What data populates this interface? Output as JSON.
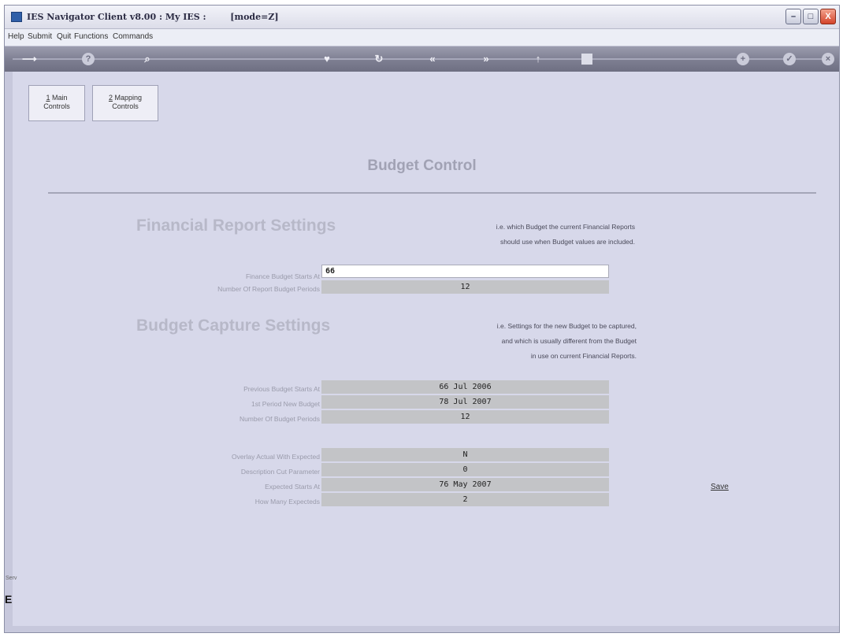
{
  "window": {
    "title": "IES Navigator Client v8.00 : My IES :        [mode=Z]",
    "buttons": {
      "minimize": "–",
      "maximize": "□",
      "close": "X"
    }
  },
  "menu": {
    "items": [
      "Help",
      "Submit",
      "Quit",
      "Functions",
      "Commands"
    ]
  },
  "toolbar": {
    "icons": [
      "arrow-right-icon",
      "help-icon",
      "search-icon",
      "heart-icon",
      "refresh-icon",
      "back-icon",
      "forward-icon",
      "up-icon",
      "stop-icon",
      "add-icon",
      "check-icon",
      "close-icon"
    ],
    "glyphs": {
      "arrow": "⟶",
      "help": "?",
      "search": "⌕",
      "heart": "♥",
      "refresh": "↻",
      "back": "«",
      "forward": "»",
      "up": "↑",
      "add": "+",
      "check": "✓",
      "close": "×"
    }
  },
  "tabs": [
    {
      "num": "1",
      "line1": "Main",
      "line2": "Controls"
    },
    {
      "num": "2",
      "line1": "Mapping",
      "line2": "Controls"
    }
  ],
  "page": {
    "title": "Budget Control"
  },
  "financial_report": {
    "title": "Financial Report Settings",
    "note": [
      "i.e. which Budget the current Financial Reports",
      "should use when Budget values are included."
    ],
    "fields": [
      {
        "label": "Finance Budget Starts At",
        "value": "66"
      },
      {
        "label": "Number Of Report Budget Periods",
        "value": "12"
      }
    ]
  },
  "budget_capture": {
    "title": "Budget Capture Settings",
    "note": [
      "i.e. Settings for the new Budget to be captured,",
      "and which is usually different from the Budget",
      "in use on current Financial Reports."
    ],
    "fields": [
      {
        "label": "Previous Budget Starts At",
        "value": "66 Jul 2006"
      },
      {
        "label": "1st Period New Budget",
        "value": "78 Jul 2007"
      },
      {
        "label": "Number Of Budget Periods",
        "value": "12"
      }
    ],
    "fields2": [
      {
        "label": "Overlay Actual With Expected",
        "value": "N"
      },
      {
        "label": "Description Cut Parameter",
        "value": "0"
      },
      {
        "label": "Expected Starts At",
        "value": "76 May 2007"
      },
      {
        "label": "How Many Expecteds",
        "value": "2"
      }
    ]
  },
  "save": {
    "label": "Save"
  },
  "left_strip": {
    "text1": "Serv",
    "text2": "E"
  }
}
